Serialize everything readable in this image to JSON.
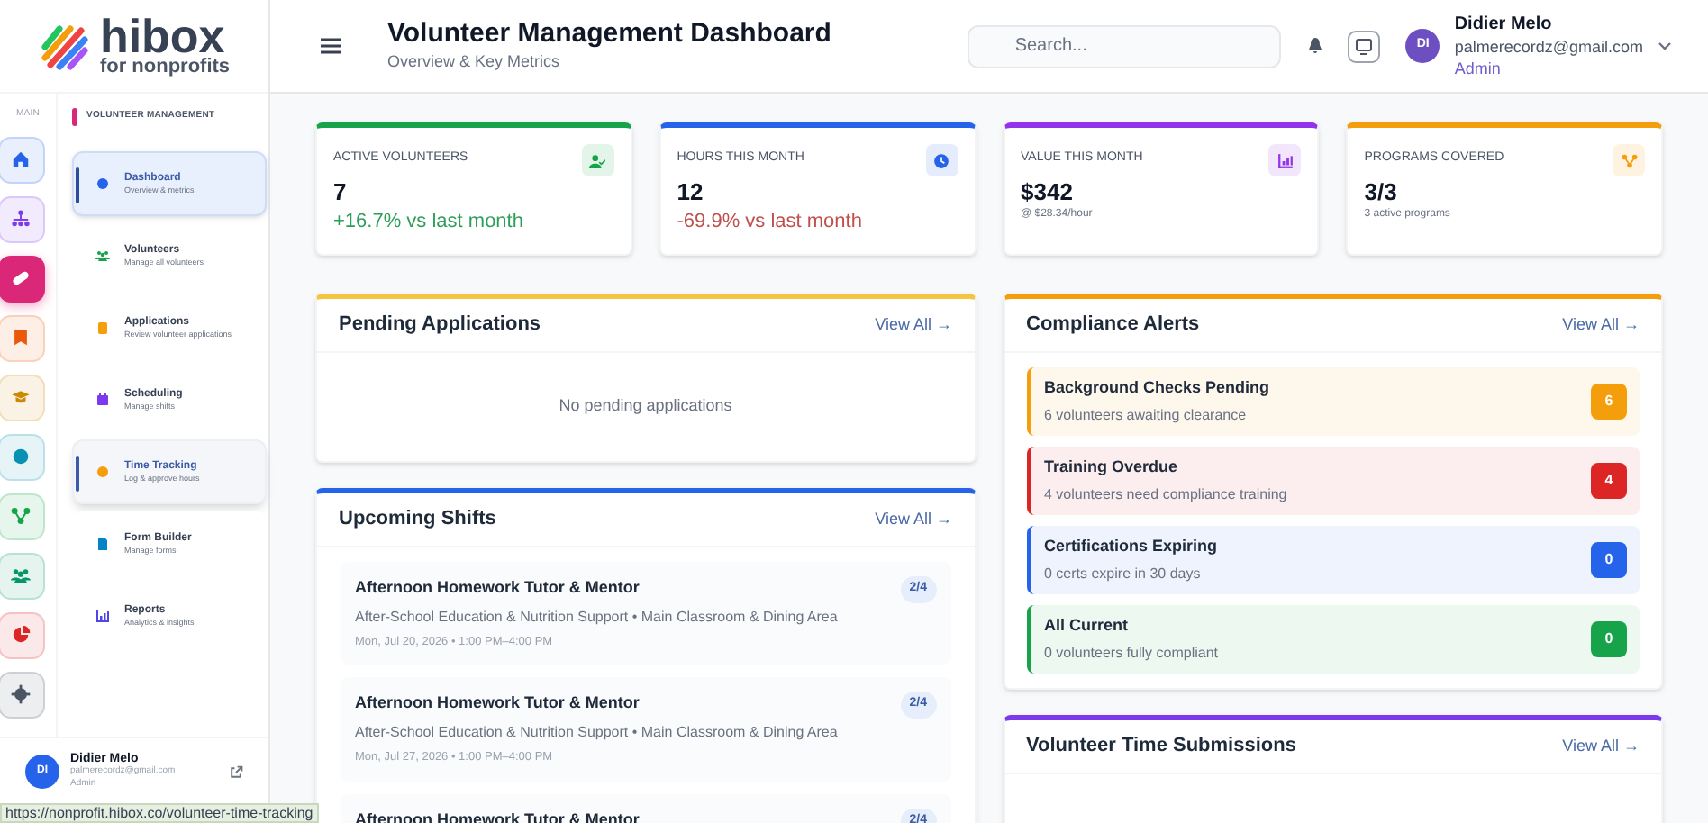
{
  "logo": {
    "name": "hibox",
    "tagline": "for nonprofits"
  },
  "rail": {
    "label": "MAIN",
    "items": [
      {
        "color": "#2563eb",
        "selected": false
      },
      {
        "color": "#7c3aed",
        "selected": false
      },
      {
        "color": "#db2777",
        "selected": true
      },
      {
        "color": "#ea580c",
        "selected": false
      },
      {
        "color": "#ca8a04",
        "selected": false
      },
      {
        "color": "#0891b2",
        "selected": false
      },
      {
        "color": "#16a34a",
        "selected": false
      },
      {
        "color": "#059669",
        "selected": false
      },
      {
        "color": "#dc2626",
        "selected": false
      },
      {
        "color": "#4b5563",
        "selected": false
      }
    ]
  },
  "nav": {
    "section": "VOLUNTEER MANAGEMENT",
    "items": [
      {
        "label": "Dashboard",
        "sublabel": "Overview & metrics",
        "color": "#2563eb",
        "selected": true,
        "hovered": false
      },
      {
        "label": "Volunteers",
        "sublabel": "Manage all volunteers",
        "color": "#16a34a",
        "selected": false,
        "hovered": false
      },
      {
        "label": "Applications",
        "sublabel": "Review volunteer applications",
        "color": "#f59e0b",
        "selected": false,
        "hovered": false
      },
      {
        "label": "Scheduling",
        "sublabel": "Manage shifts",
        "color": "#7c3aed",
        "selected": false,
        "hovered": false
      },
      {
        "label": "Time Tracking",
        "sublabel": "Log & approve hours",
        "color": "#f59e0b",
        "selected": false,
        "hovered": true
      },
      {
        "label": "Form Builder",
        "sublabel": "Manage forms",
        "color": "#0284c7",
        "selected": false,
        "hovered": false
      },
      {
        "label": "Reports",
        "sublabel": "Analytics & insights",
        "color": "#4f46e5",
        "selected": false,
        "hovered": false
      }
    ]
  },
  "sidebar_user": {
    "initials": "DI",
    "name": "Didier Melo",
    "email": "palmerecordz@gmail.com",
    "role": "Admin"
  },
  "status_bar": "https://nonprofit.hibox.co/volunteer-time-tracking",
  "header": {
    "title": "Volunteer Management Dashboard",
    "subtitle": "Overview & Key Metrics",
    "search_placeholder": "Search...",
    "user": {
      "initials": "DI",
      "name": "Didier Melo",
      "email": "palmerecordz@gmail.com",
      "role": "Admin"
    }
  },
  "stats": [
    {
      "label": "ACTIVE VOLUNTEERS",
      "value": "7",
      "note": "+16.7% vs last month",
      "kind": "up",
      "color": "#16a34a"
    },
    {
      "label": "HOURS THIS MONTH",
      "value": "12",
      "note": "-69.9% vs last month",
      "kind": "down",
      "color": "#2563eb"
    },
    {
      "label": "VALUE THIS MONTH",
      "value": "$342",
      "note": "@ $28.34/hour",
      "kind": "plain",
      "color": "#9333ea"
    },
    {
      "label": "PROGRAMS COVERED",
      "value": "3/3",
      "note": "3 active programs",
      "kind": "plain",
      "color": "#f59e0b"
    }
  ],
  "pending_applications": {
    "title": "Pending Applications",
    "link": "View All →",
    "color": "#f5c542",
    "empty": "No pending applications"
  },
  "upcoming_shifts": {
    "title": "Upcoming Shifts",
    "link": "View All →",
    "color": "#2563eb",
    "shifts": [
      {
        "title": "Afternoon Homework Tutor & Mentor",
        "place": "After-School Education & Nutrition Support • Main Classroom & Dining Area",
        "when": "Mon, Jul 20, 2026 • 1:00 PM–4:00 PM",
        "count": "2/4"
      },
      {
        "title": "Afternoon Homework Tutor & Mentor",
        "place": "After-School Education & Nutrition Support • Main Classroom & Dining Area",
        "when": "Mon, Jul 27, 2026 • 1:00 PM–4:00 PM",
        "count": "2/4"
      },
      {
        "title": "Afternoon Homework Tutor & Mentor",
        "count": "2/4"
      }
    ]
  },
  "compliance_alerts": {
    "title": "Compliance Alerts",
    "link": "View All →",
    "color": "#f59e0b",
    "alerts": [
      {
        "title": "Background Checks Pending",
        "detail": "6 volunteers awaiting clearance",
        "count": "6",
        "color": "#f59e0b"
      },
      {
        "title": "Training Overdue",
        "detail": "4 volunteers need compliance training",
        "count": "4",
        "color": "#dc2626"
      },
      {
        "title": "Certifications Expiring",
        "detail": "0 certs expire in 30 days",
        "count": "0",
        "color": "#2563eb"
      },
      {
        "title": "All Current",
        "detail": "0 volunteers fully compliant",
        "count": "0",
        "color": "#16a34a"
      }
    ]
  },
  "time_submissions": {
    "title": "Volunteer Time Submissions",
    "link": "View All →",
    "color": "#7c3aed"
  }
}
